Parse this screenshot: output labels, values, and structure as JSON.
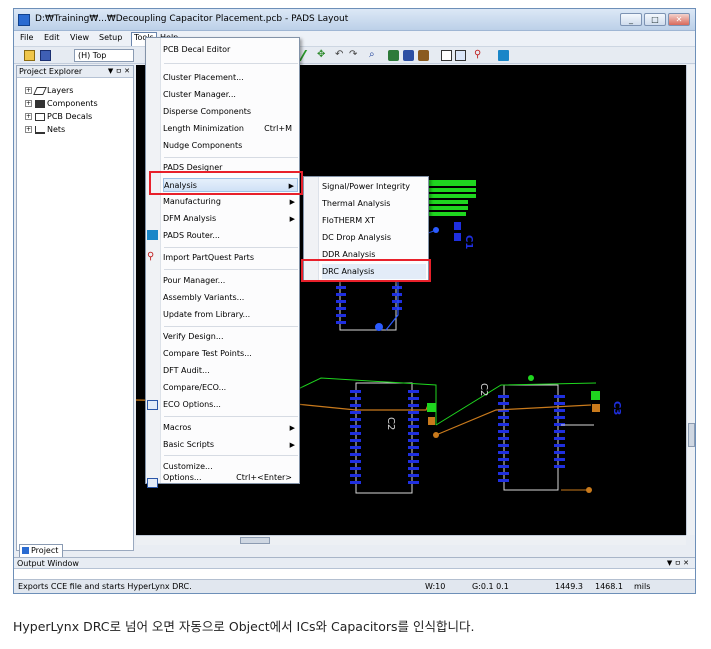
{
  "window": {
    "title": "D:₩Training₩...₩Decoupling Capacitor Placement.pcb - PADS Layout",
    "min": "_",
    "max": "□",
    "close": "✕"
  },
  "menubar": [
    "File",
    "Edit",
    "View",
    "Setup",
    "Tools",
    "Help"
  ],
  "toolbar": {
    "layer": "(H) Top"
  },
  "explorer": {
    "title": "Project Explorer",
    "controls": "▼ ㅁ ✕",
    "items": [
      "Layers",
      "Components",
      "PCB Decals",
      "Nets"
    ],
    "tab": "Project"
  },
  "tools_menu": {
    "items": [
      {
        "label": "PCB Decal Editor"
      },
      {
        "label": "Cluster Placement..."
      },
      {
        "label": "Cluster Manager..."
      },
      {
        "label": "Disperse Components"
      },
      {
        "label": "Length Minimization",
        "shortcut": "Ctrl+M"
      },
      {
        "label": "Nudge Components"
      },
      {
        "label": "PADS Designer"
      },
      {
        "label": "Analysis",
        "arrow": "▶"
      },
      {
        "label": "Manufacturing",
        "arrow": "▶"
      },
      {
        "label": "DFM Analysis",
        "arrow": "▶"
      },
      {
        "label": "PADS Router..."
      },
      {
        "label": "Import PartQuest Parts"
      },
      {
        "label": "Pour Manager..."
      },
      {
        "label": "Assembly Variants..."
      },
      {
        "label": "Update from Library..."
      },
      {
        "label": "Verify Design..."
      },
      {
        "label": "Compare Test Points..."
      },
      {
        "label": "DFT Audit..."
      },
      {
        "label": "Compare/ECO..."
      },
      {
        "label": "ECO Options..."
      },
      {
        "label": "Macros",
        "arrow": "▶"
      },
      {
        "label": "Basic Scripts",
        "arrow": "▶"
      },
      {
        "label": "Customize..."
      },
      {
        "label": "Options...",
        "shortcut": "Ctrl+<Enter>"
      }
    ]
  },
  "analysis_submenu": {
    "items": [
      "Signal/Power Integrity",
      "Thermal Analysis",
      "FloTHERM XT",
      "DC Drop Analysis",
      "DDR Analysis",
      "DRC Analysis"
    ]
  },
  "canvas": {
    "refs": [
      "C1",
      "C2",
      "C2",
      "C3"
    ]
  },
  "output_window": {
    "title": "Output Window",
    "controls": "▼ ㅁ ✕"
  },
  "statusbar": {
    "message": "Exports CCE file and starts HyperLynx DRC.",
    "width": "W:10",
    "grid": "G:0.1 0.1",
    "x": "1449.3",
    "y": "1468.1",
    "units": "mils"
  },
  "caption": "HyperLynx DRC로 넘어 오면 자동으로 Object에서 ICs와 Capacitors를 인식합니다.",
  "colors": {
    "highlight": "#e8202a",
    "pcb_bg": "#000000",
    "pad_blue": "#1f2fe0",
    "trace_green": "#1fd61f"
  }
}
